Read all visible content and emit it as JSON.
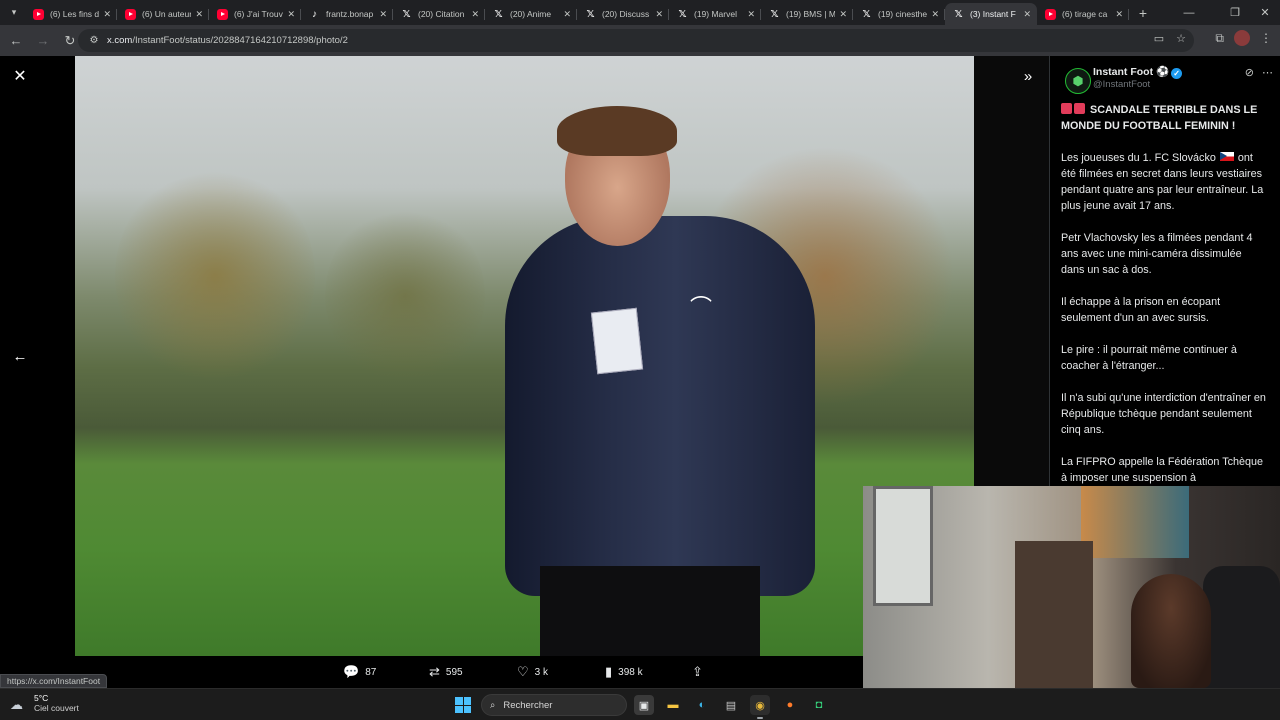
{
  "browser": {
    "tabs": [
      {
        "title": "(6) Les fins d",
        "icon": "youtube-icon",
        "active": false
      },
      {
        "title": "(6) Un auteur",
        "icon": "youtube-icon",
        "active": false
      },
      {
        "title": "(6) J'ai Trouv",
        "icon": "youtube-icon",
        "active": false
      },
      {
        "title": "frantz.bonap",
        "icon": "tiktok-icon",
        "active": false
      },
      {
        "title": "(20) Citation",
        "icon": "x-icon",
        "active": false
      },
      {
        "title": "(20) Anime",
        "icon": "x-icon",
        "active": false
      },
      {
        "title": "(20) Discuss",
        "icon": "x-icon",
        "active": false
      },
      {
        "title": "(19) Marvel",
        "icon": "x-icon",
        "active": false
      },
      {
        "title": "(19) BMS | M",
        "icon": "x-icon",
        "active": false
      },
      {
        "title": "(19) cinesthe",
        "icon": "x-icon",
        "active": false
      },
      {
        "title": "(3) Instant F",
        "icon": "x-icon",
        "active": true
      },
      {
        "title": "(6) tirage ca",
        "icon": "youtube-icon",
        "active": false
      }
    ],
    "url_host": "x.com",
    "url_path": "/InstantFoot/status/2028847164210712898/photo/2",
    "status_url": "https://x.com/InstantFoot"
  },
  "post": {
    "author_name": "Instant Foot",
    "author_handle": "@InstantFoot",
    "headline": "SCANDALE TERRIBLE DANS LE MONDE DU FOOTBALL FEMININ !",
    "para1_before_flag": "Les joueuses du 1. FC Slovácko",
    "para1_after_flag": "ont été filmées en secret dans leurs vestiaires pendant quatre ans par leur entraîneur. La plus jeune avait 17 ans.",
    "para2": "Petr Vlachovsky les a filmées pendant 4 ans avec une mini-caméra dissimulée dans un sac à dos.",
    "para3": "Il échappe à la prison en écopant seulement d'un an avec sursis.",
    "para4": "Le pire : il pourrait même continuer à coacher à l'étranger...",
    "para5": "Il n'a subi qu'une interdiction d'entraîner en République tchèque pendant seulement cinq ans.",
    "para6": "La FIFPRO appelle la Fédération Tchèque à imposer une suspension à"
  },
  "actions": {
    "replies": "87",
    "reposts": "595",
    "likes": "3 k",
    "views": "398 k"
  },
  "taskbar": {
    "temperature": "5°C",
    "weather_desc": "Ciel couvert",
    "search_placeholder": "Rechercher"
  },
  "colors": {
    "accent": "#1d9bf0",
    "background": "#000000",
    "text": "#e7e9ea",
    "muted": "#71767b"
  }
}
